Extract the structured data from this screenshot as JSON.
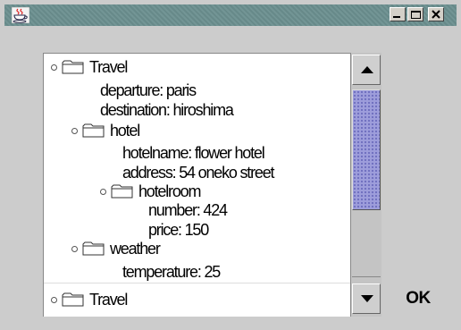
{
  "window": {
    "title": "",
    "controls": [
      "minimize-icon",
      "maximize-icon",
      "close-icon"
    ],
    "title_bar_color": "#6b8f8f"
  },
  "tree": {
    "nodes": [
      {
        "type": "folder",
        "label": "Travel"
      },
      {
        "type": "leaf",
        "label": "departure: paris"
      },
      {
        "type": "leaf",
        "label": "destination: hiroshima"
      },
      {
        "type": "folder",
        "label": "hotel"
      },
      {
        "type": "leaf",
        "label": "hotelname: flower hotel"
      },
      {
        "type": "leaf",
        "label": "address: 54 oneko street"
      },
      {
        "type": "folder",
        "label": "hotelroom"
      },
      {
        "type": "leaf",
        "label": "number: 424"
      },
      {
        "type": "leaf",
        "label": "price: 150"
      },
      {
        "type": "folder",
        "label": "weather"
      },
      {
        "type": "leaf",
        "label": "temperature: 25"
      }
    ],
    "bottom_node": {
      "type": "folder",
      "label": "Travel"
    }
  },
  "scrollbar": {
    "thumb_color": "#9d9ddb"
  },
  "ok_button": {
    "label": "OK"
  }
}
